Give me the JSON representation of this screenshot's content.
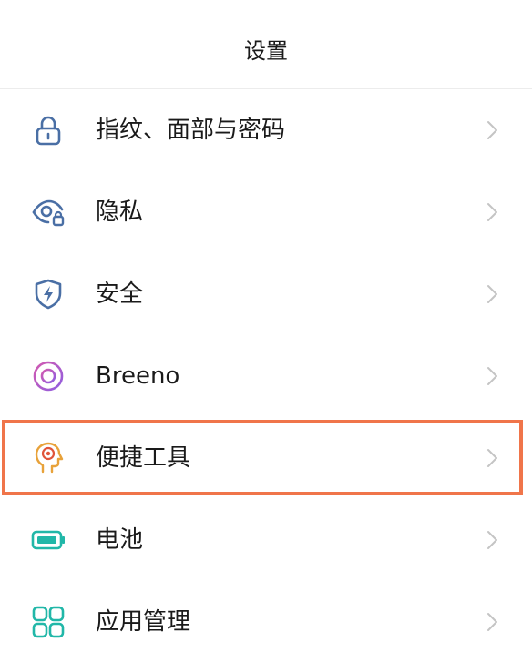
{
  "header": {
    "title": "设置"
  },
  "settings": {
    "items": [
      {
        "label": "指纹、面部与密码",
        "icon": "lock-icon",
        "color": "#4a6fa5"
      },
      {
        "label": "隐私",
        "icon": "privacy-eye-icon",
        "color": "#4a6fa5"
      },
      {
        "label": "安全",
        "icon": "shield-bolt-icon",
        "color": "#4a6fa5"
      },
      {
        "label": "Breeno",
        "icon": "breeno-ring-icon",
        "color": "#b05ad6"
      },
      {
        "label": "便捷工具",
        "icon": "head-target-icon",
        "color": "#e8a23a"
      },
      {
        "label": "电池",
        "icon": "battery-icon",
        "color": "#21b7a8"
      },
      {
        "label": "应用管理",
        "icon": "app-management-icon",
        "color": "#21b7a8"
      }
    ]
  },
  "highlight": {
    "color": "#f0754a",
    "target": "便捷工具"
  }
}
